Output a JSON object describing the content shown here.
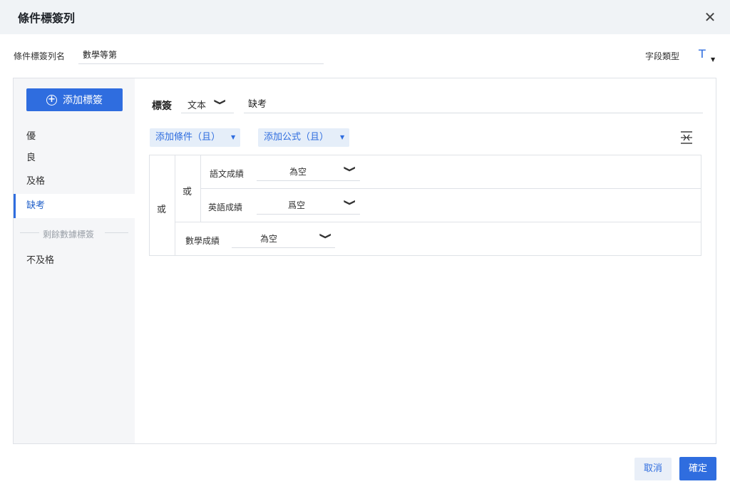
{
  "dialog": {
    "title": "條件標簽列",
    "close_glyph": "✕"
  },
  "column_name": {
    "label": "條件標簽列名",
    "value": "數學等第"
  },
  "field_type": {
    "label": "字段類型",
    "icon": "T",
    "icon_name": "text-type-icon",
    "caret": "▼"
  },
  "sidebar": {
    "add_button_label": "添加標簽",
    "add_icon": "+",
    "items": [
      {
        "label": "優"
      },
      {
        "label": "良"
      },
      {
        "label": "及格"
      },
      {
        "label": "缺考",
        "active": true
      }
    ],
    "divider_label": "剩餘數據標簽",
    "remaining_item": "不及格"
  },
  "editor": {
    "tag_label": "標簽",
    "tag_type": "文本",
    "tag_value": "缺考",
    "add_condition": "添加條件（且）",
    "add_formula": "添加公式（且）",
    "pill_caret": "▼",
    "or_outer": "或",
    "or_inner": "或",
    "chevron": "❯",
    "conditions": [
      {
        "field": "語文成績",
        "operator": "為空"
      },
      {
        "field": "英語成績",
        "operator": "爲空"
      },
      {
        "field": "數學成績",
        "operator": "為空"
      }
    ]
  },
  "footer": {
    "cancel_label": "取消",
    "confirm_label": "確定"
  },
  "colors": {
    "accent": "#2f6ddf",
    "header_bg": "#f0f3f6",
    "sidebar_bg": "#f5f6f8",
    "pill_bg": "#e5eef9"
  }
}
